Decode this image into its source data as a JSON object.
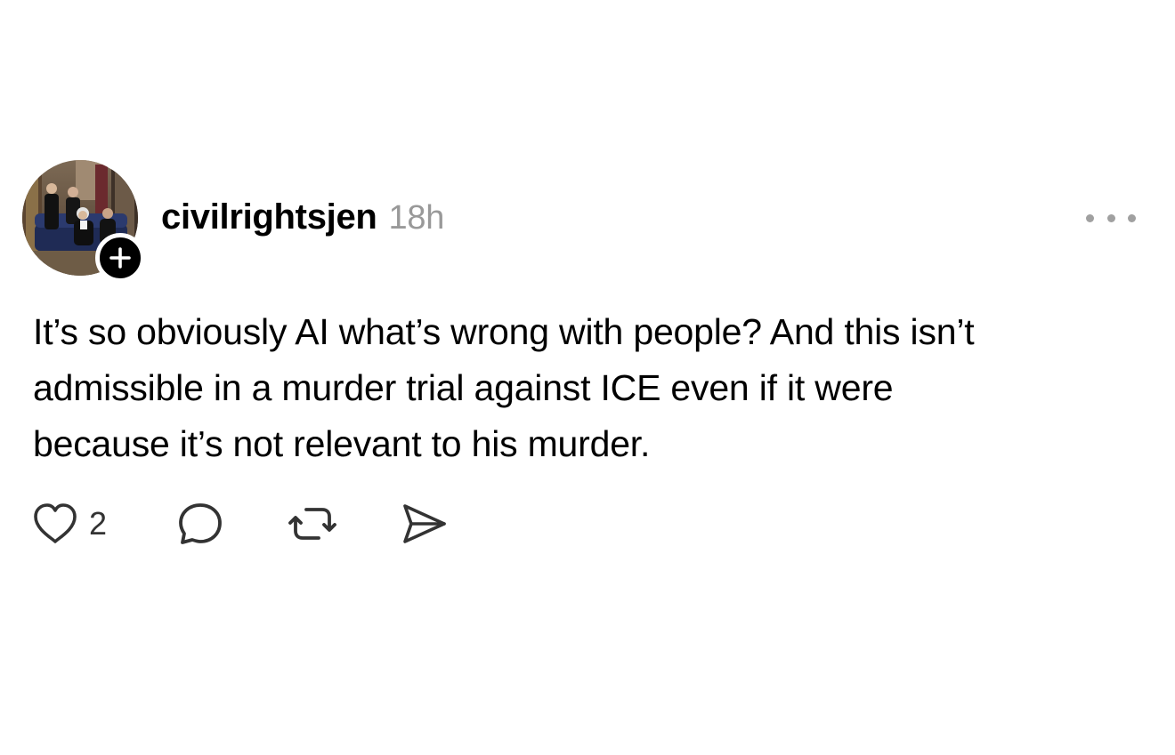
{
  "post": {
    "username": "civilrightsjen",
    "timestamp": "18h",
    "text_lines": [
      "It’s so obviously AI what’s wrong with people? And this isn’t",
      "admissible in a murder trial against ICE even if it were",
      "because it’s not relevant to his murder."
    ],
    "avatar_icon": "avatar-photo",
    "follow_icon": "plus-icon",
    "more_icon": "more-horizontal-icon"
  },
  "actions": {
    "like_count": "2",
    "like_icon": "heart-icon",
    "reply_icon": "comment-bubble-icon",
    "repost_icon": "repost-icon",
    "share_icon": "send-icon"
  },
  "colors": {
    "text": "#000000",
    "muted": "#999999",
    "icon": "#333333",
    "badge": "#000000"
  }
}
